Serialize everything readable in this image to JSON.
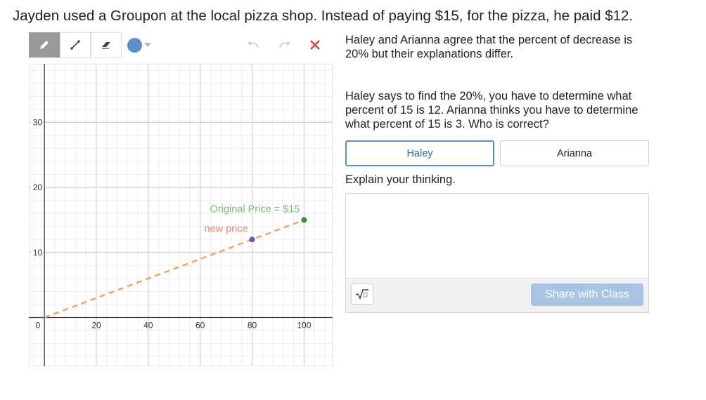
{
  "prompt": {
    "title": "Jayden used a Groupon at the local pizza shop. Instead of paying $15, for the pizza, he paid $12."
  },
  "sketch": {
    "toolbar": {
      "tools": [
        "pencil-icon",
        "line-icon",
        "eraser-icon"
      ],
      "active_tool": "pencil-icon",
      "color": "#5b8fca",
      "undo_icon": "undo-icon",
      "redo_icon": "redo-icon",
      "close_icon": "close-icon",
      "close_color": "#d64545"
    },
    "chart_data": {
      "type": "line",
      "x_ticks": [
        "0",
        "20",
        "40",
        "60",
        "80",
        "100"
      ],
      "y_ticks": [
        "10",
        "20",
        "30"
      ],
      "xlim": [
        -6,
        111
      ],
      "ylim": [
        -7.5,
        39
      ],
      "grid": true,
      "series": [
        {
          "points": [
            [
              0,
              0
            ],
            [
              100,
              15
            ]
          ],
          "color": "#f4a460",
          "dashed": true
        }
      ],
      "points": [
        {
          "x": 80,
          "y": 12,
          "color": "#5b5ea6"
        },
        {
          "x": 100,
          "y": 15,
          "color": "#3c8b3c"
        }
      ],
      "annotations": [
        {
          "text": "Original Price = $15",
          "color": "#7dbb7d"
        },
        {
          "text": "new price",
          "color": "#e08a7a"
        }
      ]
    }
  },
  "question": {
    "statement1": "Haley and Arianna agree that the percent of decrease is 20% but their explanations differ.",
    "statement2": "Haley says to find the 20%, you have to determine what percent of 15 is 12.  Arianna thinks you have to determine what percent of 15 is 3.  Who is correct?",
    "choices": [
      "Haley",
      "Arianna"
    ],
    "selected": "Haley",
    "explain_label": "Explain your thinking.",
    "answer_value": "",
    "math_icon": "square-root-icon",
    "share_label": "Share with Class"
  }
}
